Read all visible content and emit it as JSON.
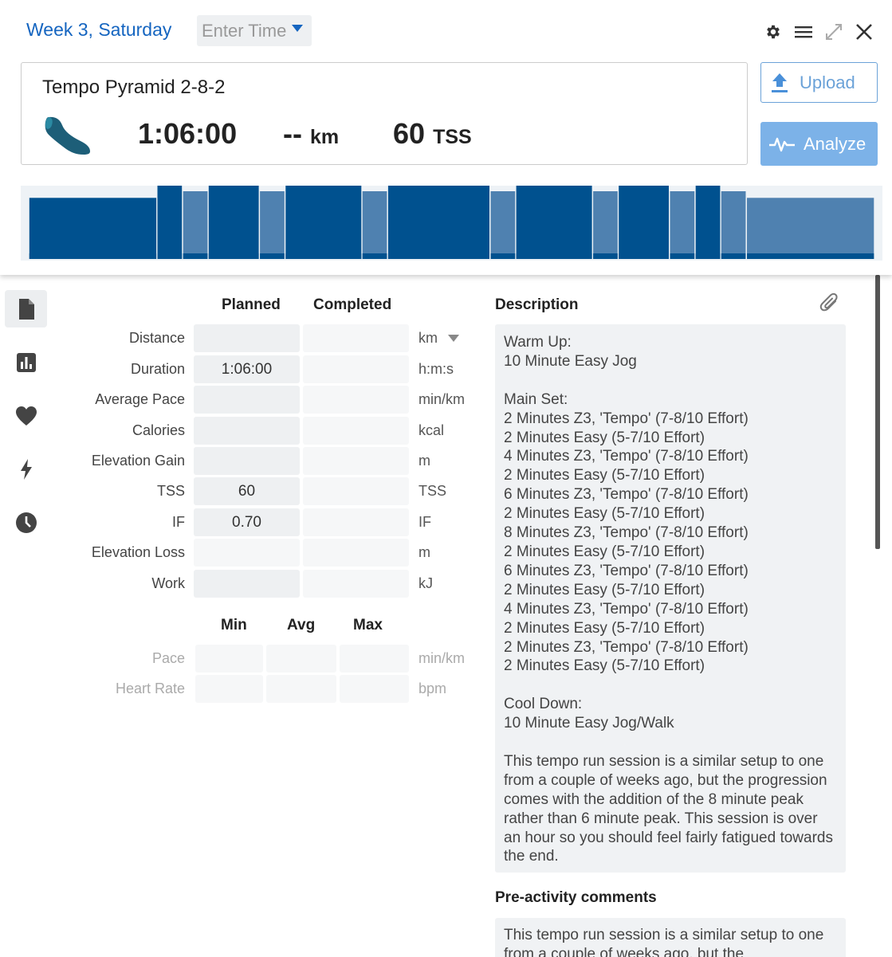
{
  "header": {
    "date_title": "Week 3, Saturday",
    "time_picker_placeholder": "Enter Time",
    "icons": [
      "gear-icon",
      "menu-icon",
      "expand-icon",
      "close-icon"
    ]
  },
  "summary": {
    "workout_name": "Tempo Pyramid 2-8-2",
    "sport_icon": "running-shoe-icon",
    "duration": "1:06:00",
    "distance_value": "--",
    "distance_unit": "km",
    "tss_value": "60",
    "tss_unit": "TSS"
  },
  "actions": {
    "upload_label": "Upload",
    "analyze_label": "Analyze"
  },
  "workout_profile": {
    "segments": [
      {
        "minutes": 10,
        "intensity": 0.65,
        "kind": "warmup"
      },
      {
        "minutes": 2,
        "intensity": 0.85,
        "kind": "work"
      },
      {
        "minutes": 2,
        "intensity": 0.72,
        "kind": "recovery"
      },
      {
        "minutes": 4,
        "intensity": 0.85,
        "kind": "work"
      },
      {
        "minutes": 2,
        "intensity": 0.72,
        "kind": "recovery"
      },
      {
        "minutes": 6,
        "intensity": 0.85,
        "kind": "work"
      },
      {
        "minutes": 2,
        "intensity": 0.72,
        "kind": "recovery"
      },
      {
        "minutes": 8,
        "intensity": 0.85,
        "kind": "work"
      },
      {
        "minutes": 2,
        "intensity": 0.72,
        "kind": "recovery"
      },
      {
        "minutes": 6,
        "intensity": 0.85,
        "kind": "work"
      },
      {
        "minutes": 2,
        "intensity": 0.72,
        "kind": "recovery"
      },
      {
        "minutes": 4,
        "intensity": 0.85,
        "kind": "work"
      },
      {
        "minutes": 2,
        "intensity": 0.72,
        "kind": "recovery"
      },
      {
        "minutes": 2,
        "intensity": 0.85,
        "kind": "work"
      },
      {
        "minutes": 2,
        "intensity": 0.72,
        "kind": "recovery"
      },
      {
        "minutes": 10,
        "intensity": 0.65,
        "kind": "cooldown"
      }
    ],
    "colors": {
      "work": "#00518f",
      "recovery": "#4f81b0",
      "warmup": "#00518f",
      "cooldown": "#4f81b0",
      "background": "#eef2f6"
    }
  },
  "rail": {
    "items": [
      {
        "icon": "document-icon",
        "active": true
      },
      {
        "icon": "bar-chart-icon",
        "active": false
      },
      {
        "icon": "heart-icon",
        "active": false
      },
      {
        "icon": "lightning-icon",
        "active": false
      },
      {
        "icon": "clock-icon",
        "active": false
      }
    ]
  },
  "metrics": {
    "col_planned": "Planned",
    "col_completed": "Completed",
    "rows": [
      {
        "label": "Distance",
        "planned": "",
        "completed": "",
        "unit": "km"
      },
      {
        "label": "Duration",
        "planned": "1:06:00",
        "completed": "",
        "unit": "h:m:s"
      },
      {
        "label": "Average Pace",
        "planned": "",
        "completed": "",
        "unit": "min/km"
      },
      {
        "label": "Calories",
        "planned": "",
        "completed": "",
        "unit": "kcal"
      },
      {
        "label": "Elevation Gain",
        "planned": "",
        "completed": "",
        "unit": "m"
      },
      {
        "label": "TSS",
        "planned": "60",
        "completed": "",
        "unit": "TSS"
      },
      {
        "label": "IF",
        "planned": "0.70",
        "completed": "",
        "unit": "IF"
      },
      {
        "label": "Elevation Loss",
        "planned": "",
        "completed": "",
        "unit": "m"
      },
      {
        "label": "Work",
        "planned": "",
        "completed": "",
        "unit": "kJ"
      }
    ]
  },
  "range": {
    "col_min": "Min",
    "col_avg": "Avg",
    "col_max": "Max",
    "rows": [
      {
        "label": "Pace",
        "unit": "min/km"
      },
      {
        "label": "Heart Rate",
        "unit": "bpm"
      }
    ]
  },
  "description": {
    "title": "Description",
    "attach_icon": "paperclip-icon",
    "text": "Warm Up:\n10 Minute Easy Jog\n\nMain Set:\n2 Minutes Z3, 'Tempo' (7-8/10 Effort)\n2 Minutes Easy (5-7/10 Effort)\n4 Minutes Z3, 'Tempo' (7-8/10 Effort)\n2 Minutes Easy (5-7/10 Effort)\n6 Minutes Z3, 'Tempo' (7-8/10 Effort)\n2 Minutes Easy (5-7/10 Effort)\n8 Minutes Z3, 'Tempo' (7-8/10 Effort)\n2 Minutes Easy (5-7/10 Effort)\n6 Minutes Z3, 'Tempo' (7-8/10 Effort)\n2 Minutes Easy (5-7/10 Effort)\n4 Minutes Z3, 'Tempo' (7-8/10 Effort)\n2 Minutes Easy (5-7/10 Effort)\n2 Minutes Z3, 'Tempo' (7-8/10 Effort)\n2 Minutes Easy (5-7/10 Effort)\n\nCool Down:\n10 Minute Easy Jog/Walk\n\nThis tempo run session is a similar setup to one from a couple of weeks ago, but the progression comes with the addition of the 8 minute peak rather than 6 minute peak. This session is over an hour so you should feel fairly fatigued towards the end."
  },
  "pre_activity": {
    "title": "Pre-activity comments",
    "text": "This tempo run session is a similar setup to one from a couple of weeks ago, but the"
  }
}
